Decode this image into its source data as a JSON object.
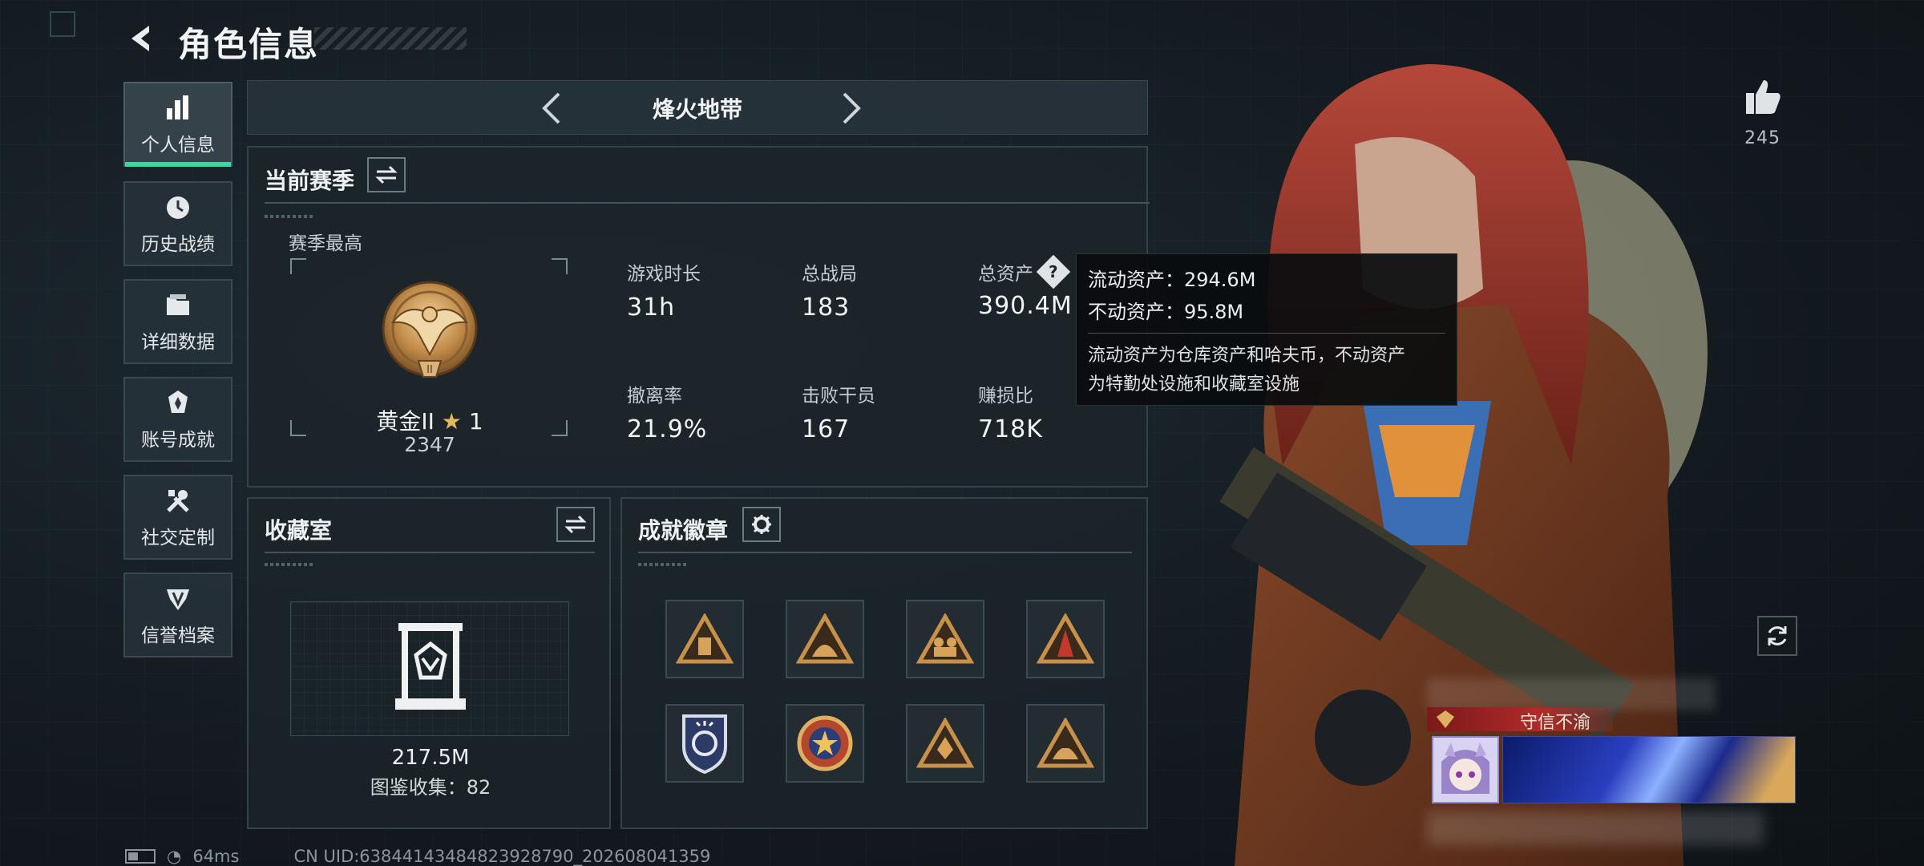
{
  "header": {
    "title": "角色信息",
    "back_icon": "back-arrow-icon"
  },
  "sidebar": {
    "items": [
      {
        "label": "个人信息",
        "icon": "bar-chart-icon",
        "active": true
      },
      {
        "label": "历史战绩",
        "icon": "history-icon",
        "active": false
      },
      {
        "label": "详细数据",
        "icon": "folder-icon",
        "active": false
      },
      {
        "label": "账号成就",
        "icon": "achievement-icon",
        "active": false
      },
      {
        "label": "社交定制",
        "icon": "tools-icon",
        "active": false
      },
      {
        "label": "信誉档案",
        "icon": "credit-icon",
        "active": false
      }
    ]
  },
  "mode_selector": {
    "label": "烽火地带"
  },
  "season": {
    "title": "当前赛季",
    "best_label": "赛季最高",
    "rank_name": "黄金II",
    "rank_stars": "1",
    "rank_points": "2347",
    "stats": [
      {
        "label": "游戏时长",
        "value": "31h"
      },
      {
        "label": "总战局",
        "value": "183"
      },
      {
        "label": "总资产",
        "value": "390.4M"
      },
      {
        "label": "撤离率",
        "value": "21.9%"
      },
      {
        "label": "击败干员",
        "value": "167"
      },
      {
        "label": "赚损比",
        "value": "718K"
      }
    ]
  },
  "tooltip": {
    "liquid": "流动资产：294.6M",
    "fixed": "不动资产：95.8M",
    "desc_line1": "流动资产为仓库资产和哈夫币，不动资产",
    "desc_line2": "为特勤处设施和收藏室设施"
  },
  "collection": {
    "title": "收藏室",
    "value": "217.5M",
    "catalog": "图鉴收集：82"
  },
  "achievements": {
    "title": "成就徽章",
    "badges": [
      "triangle-badge-icon",
      "triangle-badge-icon",
      "triangle-badge-icon",
      "triangle-badge-icon",
      "shield-badge-icon",
      "star-round-badge-icon",
      "triangle-badge-icon",
      "triangle-badge-icon"
    ]
  },
  "right": {
    "like_count": "245",
    "title_tag": "守信不渝"
  },
  "status": {
    "ping": "64ms",
    "uid": "CN UID:63844143484823928790_202608041359"
  },
  "colors": {
    "accent": "#3fd6a0",
    "title_tag_bg": "#8b1e1e",
    "bronze": "#b98a4a"
  }
}
